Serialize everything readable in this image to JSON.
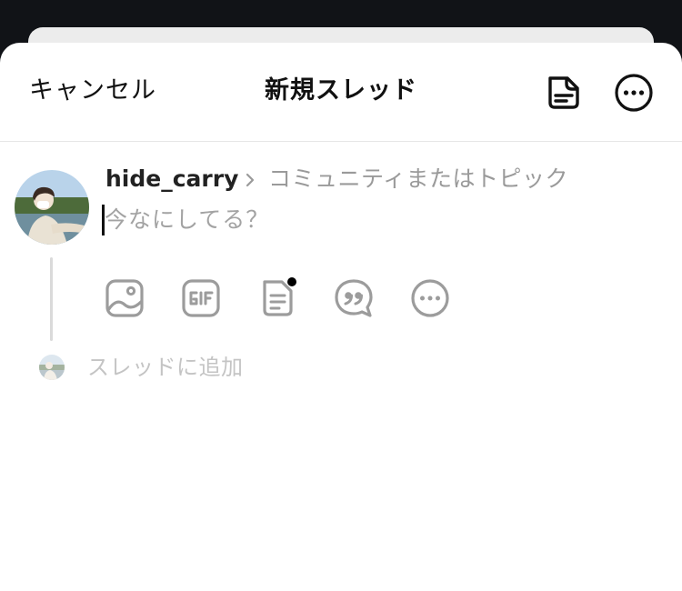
{
  "header": {
    "cancel_label": "キャンセル",
    "title": "新規スレッド",
    "drafts_icon": "drafts-icon",
    "more_icon": "more-options-icon"
  },
  "composer": {
    "username": "hide_carry",
    "topic_placeholder": "コミュニティまたはトピック",
    "body_placeholder": "今なにしてる？",
    "toolbar": [
      {
        "icon": "image-icon"
      },
      {
        "icon": "gif-icon"
      },
      {
        "icon": "poll-icon",
        "has_new_indicator": true
      },
      {
        "icon": "quote-icon"
      },
      {
        "icon": "more-icon"
      }
    ]
  },
  "add_thread": {
    "label": "スレッドに追加"
  },
  "colors": {
    "background_dark": "#111317",
    "sheet": "#ffffff",
    "text_primary": "#111111",
    "text_muted": "#9a9a9a",
    "text_faint": "#c4c4c4",
    "icon_muted": "#9c9c9c"
  }
}
